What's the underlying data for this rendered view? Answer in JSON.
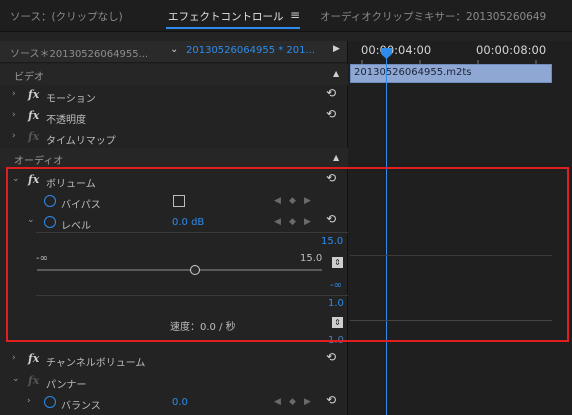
{
  "tabs": {
    "source": "ソース：(クリップなし)",
    "effect_controls": "エフェクトコントロール",
    "audio_mixer": "オーディオクリップミキサー：201305260649"
  },
  "header": {
    "source_clip": "ソース＊20130526064955...",
    "sequence_clip": "20130526064955 * 201..."
  },
  "timeline": {
    "timecode_1": "00:00:04:00",
    "timecode_2": "00:00:08:00",
    "clip_name": "20130526064955.m2ts"
  },
  "video": {
    "section_label": "ビデオ",
    "effects": [
      "モーション",
      "不透明度",
      "タイムリマップ"
    ]
  },
  "audio": {
    "section_label": "オーディオ",
    "volume_label": "ボリューム",
    "bypass_label": "バイパス",
    "level_label": "レベル",
    "level_value": "0.0 dB",
    "level_max_right": "15.0",
    "level_min_right": "-∞",
    "slider_min": "-∞",
    "slider_max": "15.0",
    "speed_max": "1.0",
    "speed_min": "1.0",
    "speed_label": "速度：0.0 / 秒",
    "channel_volume_label": "チャンネルボリューム",
    "panner_label": "パンナー",
    "balance_label": "バランス",
    "balance_value": "0.0"
  },
  "colors": {
    "accent": "#2d8ceb",
    "highlight_box": "#e02020",
    "clip": "#8fa8d3"
  }
}
